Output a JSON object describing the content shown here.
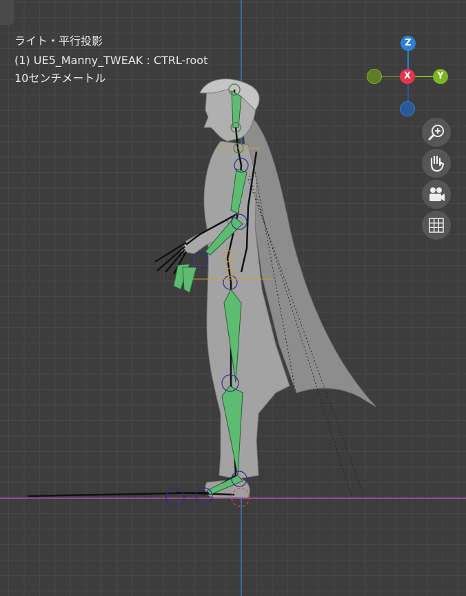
{
  "viewport": {
    "view_title": "ライト・平行投影",
    "object_name": "(1) UE5_Manny_TWEAK : CTRL-root",
    "scale_info": "10センチメートル"
  },
  "gizmo": {
    "z_label": "Z",
    "x_label": "X",
    "y_label": "Y",
    "colors": {
      "x": "#e8334a",
      "y": "#7fb522",
      "z": "#2f7ed8",
      "neg_y": "#5f7c28",
      "neg_z": "#2a5a94"
    }
  },
  "nav_tools": {
    "zoom": "zoom-icon",
    "pan": "hand-icon",
    "camera": "camera-icon",
    "ortho": "grid-icon"
  },
  "colors": {
    "background": "#3d3d3d",
    "grid_line": "#474747",
    "x_axis": "#b94ab5",
    "z_axis": "#4a78c8",
    "bone_fill": "#5dbb72"
  }
}
